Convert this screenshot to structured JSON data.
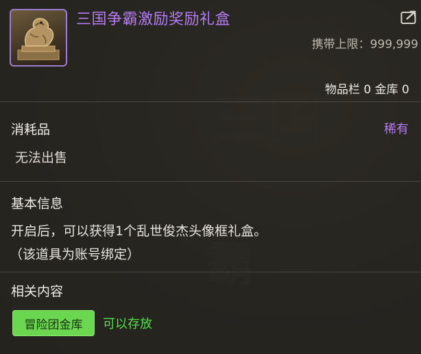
{
  "item": {
    "name": "三国争霸激励奖励礼盒",
    "carry_limit": "携带上限：999,999",
    "inventory": "物品栏 0 金库 0"
  },
  "sections": {
    "consumable": {
      "title": "消耗品",
      "rarity": "稀有",
      "note": "无法出售"
    },
    "basic_info": {
      "title": "基本信息",
      "line1": "开启后，可以获得1个乱世俊杰头像框礼盒。",
      "line2": "（该道具为账号绑定）"
    },
    "related": {
      "title": "相关内容",
      "button_label": "冒险团金库",
      "status": "可以存放"
    }
  },
  "colors": {
    "rarity_purple": "#b57cf2",
    "green_button": "#6bd64f",
    "green_text": "#55e04a"
  },
  "icons": {
    "item_icon": "dragon-statue-icon",
    "share": "share-icon"
  }
}
